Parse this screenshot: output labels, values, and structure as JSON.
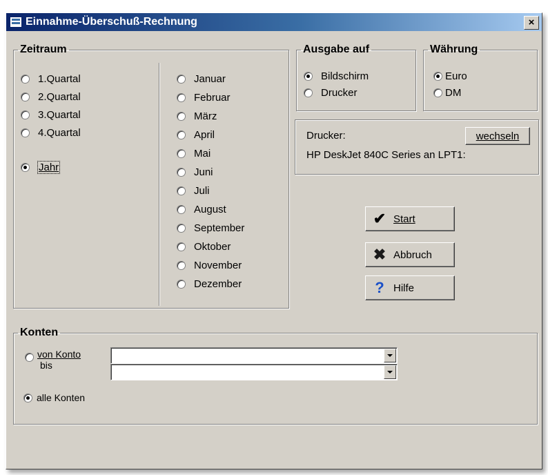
{
  "window": {
    "title": "Einnahme-Überschuß-Rechnung",
    "close_label": "×"
  },
  "zeitraum": {
    "legend": "Zeitraum",
    "quarters": [
      "1.Quartal",
      "2.Quartal",
      "3.Quartal",
      "4.Quartal"
    ],
    "year": "Jahr",
    "months": [
      "Januar",
      "Februar",
      "März",
      "April",
      "Mai",
      "Juni",
      "Juli",
      "August",
      "September",
      "Oktober",
      "November",
      "Dezember"
    ],
    "selected": "Jahr"
  },
  "ausgabe": {
    "legend": "Ausgabe auf",
    "options": [
      "Bildschirm",
      "Drucker"
    ],
    "selected": "Bildschirm"
  },
  "waehrung": {
    "legend": "Währung",
    "options": [
      "Euro",
      "DM"
    ],
    "selected": "Euro"
  },
  "drucker": {
    "label": "Drucker:",
    "change_label": "wechseln",
    "name": "HP DeskJet 840C Series an LPT1:"
  },
  "buttons": {
    "start": "Start",
    "abbruch": "Abbruch",
    "hilfe": "Hilfe"
  },
  "konten": {
    "legend": "Konten",
    "von_label": "von Konto",
    "bis_label": "bis",
    "von_value": "",
    "bis_value": "",
    "alle_label": "alle Konten",
    "selected": "alle Konten"
  }
}
